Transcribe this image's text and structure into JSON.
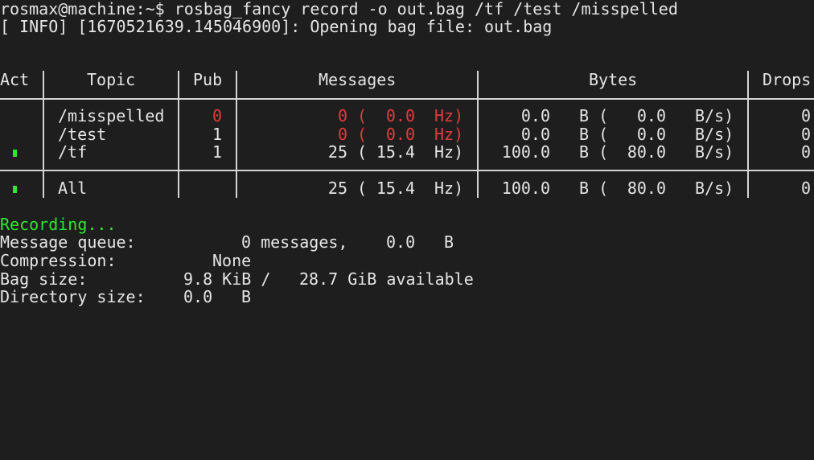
{
  "terminal": {
    "command_line": "rosmax@machine:~$ rosbag_fancy record -o out.bag /tf /test /misspelled",
    "info_line": "[ INFO] [1670521639.145046900]: Opening bag file: out.bag"
  },
  "table": {
    "headers": {
      "act": "Act",
      "topic": "Topic",
      "pub": "Pub",
      "messages": "Messages",
      "bytes": "Bytes",
      "drops": "Drops"
    },
    "rows": [
      {
        "active": false,
        "topic": "/misspelled",
        "pub": "0",
        "pub_alert": true,
        "msg_count": "0",
        "msg_rate": "0.0",
        "msg_unit": "Hz)",
        "msg_alert": true,
        "bytes": "0.0",
        "bytes_unit": "B (",
        "bytes_rate": "0.0",
        "bytes_rate_unit": "B/s)",
        "drops": "0"
      },
      {
        "active": false,
        "topic": "/test",
        "pub": "1",
        "pub_alert": false,
        "msg_count": "0",
        "msg_rate": "0.0",
        "msg_unit": "Hz)",
        "msg_alert": true,
        "bytes": "0.0",
        "bytes_unit": "B (",
        "bytes_rate": "0.0",
        "bytes_rate_unit": "B/s)",
        "drops": "0"
      },
      {
        "active": true,
        "topic": "/tf",
        "pub": "1",
        "pub_alert": false,
        "msg_count": "25",
        "msg_rate": "15.4",
        "msg_unit": "Hz)",
        "msg_alert": false,
        "bytes": "100.0",
        "bytes_unit": "B (",
        "bytes_rate": "80.0",
        "bytes_rate_unit": "B/s)",
        "drops": "0"
      }
    ],
    "total": {
      "active": true,
      "topic": "All",
      "msg_count": "25",
      "msg_rate": "15.4",
      "msg_unit": "Hz)",
      "bytes": "100.0",
      "bytes_unit": "B (",
      "bytes_rate": "80.0",
      "bytes_rate_unit": "B/s)",
      "drops": "0"
    },
    "paren_open": "(",
    "colors": {
      "alert": "#e03c3c",
      "active": "#2ee82e",
      "text": "#e5e5e5",
      "background": "#1e1e1e"
    }
  },
  "status": {
    "recording": "Recording...",
    "queue_label": "Message queue:",
    "queue_value": "0 messages,",
    "queue_bytes": "0.0",
    "queue_bytes_unit": "B",
    "compression_label": "Compression:",
    "compression_value": "None",
    "bag_size_label": "Bag size:",
    "bag_size_value": "9.8 KiB /",
    "bag_size_available": "28.7 GiB available",
    "dir_size_label": "Directory size:",
    "dir_size_value": "0.0",
    "dir_size_unit": "B"
  }
}
